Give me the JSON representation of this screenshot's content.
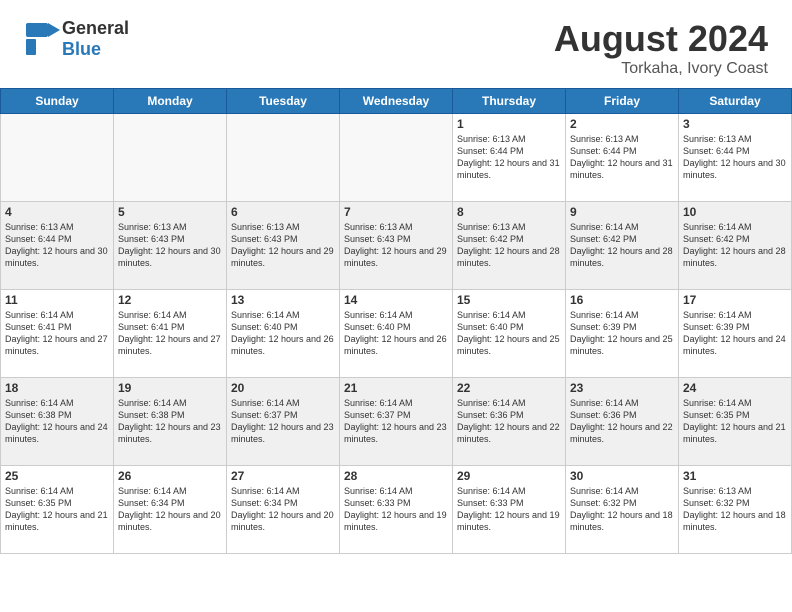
{
  "header": {
    "logo_general": "General",
    "logo_blue": "Blue",
    "month_year": "August 2024",
    "location": "Torkaha, Ivory Coast"
  },
  "days_of_week": [
    "Sunday",
    "Monday",
    "Tuesday",
    "Wednesday",
    "Thursday",
    "Friday",
    "Saturday"
  ],
  "weeks": [
    [
      {
        "day": "",
        "empty": true
      },
      {
        "day": "",
        "empty": true
      },
      {
        "day": "",
        "empty": true
      },
      {
        "day": "",
        "empty": true
      },
      {
        "day": "1",
        "sunrise": "6:13 AM",
        "sunset": "6:44 PM",
        "daylight": "12 hours and 31 minutes."
      },
      {
        "day": "2",
        "sunrise": "6:13 AM",
        "sunset": "6:44 PM",
        "daylight": "12 hours and 31 minutes."
      },
      {
        "day": "3",
        "sunrise": "6:13 AM",
        "sunset": "6:44 PM",
        "daylight": "12 hours and 30 minutes."
      }
    ],
    [
      {
        "day": "4",
        "sunrise": "6:13 AM",
        "sunset": "6:44 PM",
        "daylight": "12 hours and 30 minutes."
      },
      {
        "day": "5",
        "sunrise": "6:13 AM",
        "sunset": "6:43 PM",
        "daylight": "12 hours and 30 minutes."
      },
      {
        "day": "6",
        "sunrise": "6:13 AM",
        "sunset": "6:43 PM",
        "daylight": "12 hours and 29 minutes."
      },
      {
        "day": "7",
        "sunrise": "6:13 AM",
        "sunset": "6:43 PM",
        "daylight": "12 hours and 29 minutes."
      },
      {
        "day": "8",
        "sunrise": "6:13 AM",
        "sunset": "6:42 PM",
        "daylight": "12 hours and 28 minutes."
      },
      {
        "day": "9",
        "sunrise": "6:14 AM",
        "sunset": "6:42 PM",
        "daylight": "12 hours and 28 minutes."
      },
      {
        "day": "10",
        "sunrise": "6:14 AM",
        "sunset": "6:42 PM",
        "daylight": "12 hours and 28 minutes."
      }
    ],
    [
      {
        "day": "11",
        "sunrise": "6:14 AM",
        "sunset": "6:41 PM",
        "daylight": "12 hours and 27 minutes."
      },
      {
        "day": "12",
        "sunrise": "6:14 AM",
        "sunset": "6:41 PM",
        "daylight": "12 hours and 27 minutes."
      },
      {
        "day": "13",
        "sunrise": "6:14 AM",
        "sunset": "6:40 PM",
        "daylight": "12 hours and 26 minutes."
      },
      {
        "day": "14",
        "sunrise": "6:14 AM",
        "sunset": "6:40 PM",
        "daylight": "12 hours and 26 minutes."
      },
      {
        "day": "15",
        "sunrise": "6:14 AM",
        "sunset": "6:40 PM",
        "daylight": "12 hours and 25 minutes."
      },
      {
        "day": "16",
        "sunrise": "6:14 AM",
        "sunset": "6:39 PM",
        "daylight": "12 hours and 25 minutes."
      },
      {
        "day": "17",
        "sunrise": "6:14 AM",
        "sunset": "6:39 PM",
        "daylight": "12 hours and 24 minutes."
      }
    ],
    [
      {
        "day": "18",
        "sunrise": "6:14 AM",
        "sunset": "6:38 PM",
        "daylight": "12 hours and 24 minutes."
      },
      {
        "day": "19",
        "sunrise": "6:14 AM",
        "sunset": "6:38 PM",
        "daylight": "12 hours and 23 minutes."
      },
      {
        "day": "20",
        "sunrise": "6:14 AM",
        "sunset": "6:37 PM",
        "daylight": "12 hours and 23 minutes."
      },
      {
        "day": "21",
        "sunrise": "6:14 AM",
        "sunset": "6:37 PM",
        "daylight": "12 hours and 23 minutes."
      },
      {
        "day": "22",
        "sunrise": "6:14 AM",
        "sunset": "6:36 PM",
        "daylight": "12 hours and 22 minutes."
      },
      {
        "day": "23",
        "sunrise": "6:14 AM",
        "sunset": "6:36 PM",
        "daylight": "12 hours and 22 minutes."
      },
      {
        "day": "24",
        "sunrise": "6:14 AM",
        "sunset": "6:35 PM",
        "daylight": "12 hours and 21 minutes."
      }
    ],
    [
      {
        "day": "25",
        "sunrise": "6:14 AM",
        "sunset": "6:35 PM",
        "daylight": "12 hours and 21 minutes."
      },
      {
        "day": "26",
        "sunrise": "6:14 AM",
        "sunset": "6:34 PM",
        "daylight": "12 hours and 20 minutes."
      },
      {
        "day": "27",
        "sunrise": "6:14 AM",
        "sunset": "6:34 PM",
        "daylight": "12 hours and 20 minutes."
      },
      {
        "day": "28",
        "sunrise": "6:14 AM",
        "sunset": "6:33 PM",
        "daylight": "12 hours and 19 minutes."
      },
      {
        "day": "29",
        "sunrise": "6:14 AM",
        "sunset": "6:33 PM",
        "daylight": "12 hours and 19 minutes."
      },
      {
        "day": "30",
        "sunrise": "6:14 AM",
        "sunset": "6:32 PM",
        "daylight": "12 hours and 18 minutes."
      },
      {
        "day": "31",
        "sunrise": "6:13 AM",
        "sunset": "6:32 PM",
        "daylight": "12 hours and 18 minutes."
      }
    ]
  ],
  "labels": {
    "sunrise": "Sunrise:",
    "sunset": "Sunset:",
    "daylight": "Daylight:"
  }
}
